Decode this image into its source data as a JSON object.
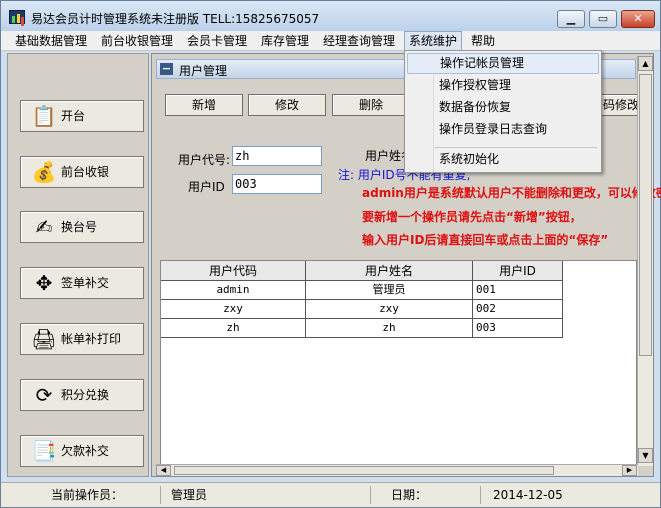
{
  "window": {
    "title": "易达会员计时管理系统未注册版 TELL:15825675057",
    "minimize": "▁",
    "maximize": "▭",
    "close": "✕"
  },
  "menubar": {
    "items": [
      "基础数据管理",
      "前台收银管理",
      "会员卡管理",
      "库存管理",
      "经理查询管理",
      "系统维护",
      "帮助"
    ],
    "active_index": 5
  },
  "dropdown": {
    "items": [
      "操作记帐员管理",
      "操作授权管理",
      "数据备份恢复",
      "操作员登录日志查询",
      "系统初始化"
    ],
    "highlighted_index": 0
  },
  "sidebar": {
    "items": [
      {
        "label": "开台",
        "icon": "register-icon"
      },
      {
        "label": "前台收银",
        "icon": "money-bag-icon"
      },
      {
        "label": "换台号",
        "icon": "swap-icon"
      },
      {
        "label": "签单补交",
        "icon": "sign-icon"
      },
      {
        "label": "帐单补打印",
        "icon": "printer-icon"
      },
      {
        "label": "积分兑换",
        "icon": "exchange-icon"
      },
      {
        "label": "欠款补交",
        "icon": "debt-icon"
      }
    ]
  },
  "panel": {
    "title": "用户管理",
    "collapse": "−"
  },
  "toolbar": {
    "add": "新增",
    "edit": "修改",
    "delete": "删除",
    "pwd": "密码修改"
  },
  "form": {
    "user_code_label": "用户代号:",
    "user_code_value": "zh",
    "user_id_label": "用户ID",
    "user_id_value": "003",
    "user_name_label": "用户姓名",
    "note": "注: 用户ID号不能有重复,",
    "warn1": "admin用户是系统默认用户不能删除和更改，可以修改密码",
    "warn2": "要新增一个操作员请先点击“新增”按钮，",
    "warn3": "输入用户ID后请直接回车或点击上面的“保存”"
  },
  "table": {
    "headers": [
      "用户代码",
      "用户姓名",
      "用户ID"
    ],
    "rows": [
      [
        "admin",
        "管理员",
        "001"
      ],
      [
        "zxy",
        "zxy",
        "002"
      ],
      [
        "zh",
        "zh",
        "003"
      ]
    ]
  },
  "statusbar": {
    "operator_label": "当前操作员：",
    "operator_value": "管理员",
    "date_label": "日期：",
    "date_value": "2014-12-05"
  }
}
